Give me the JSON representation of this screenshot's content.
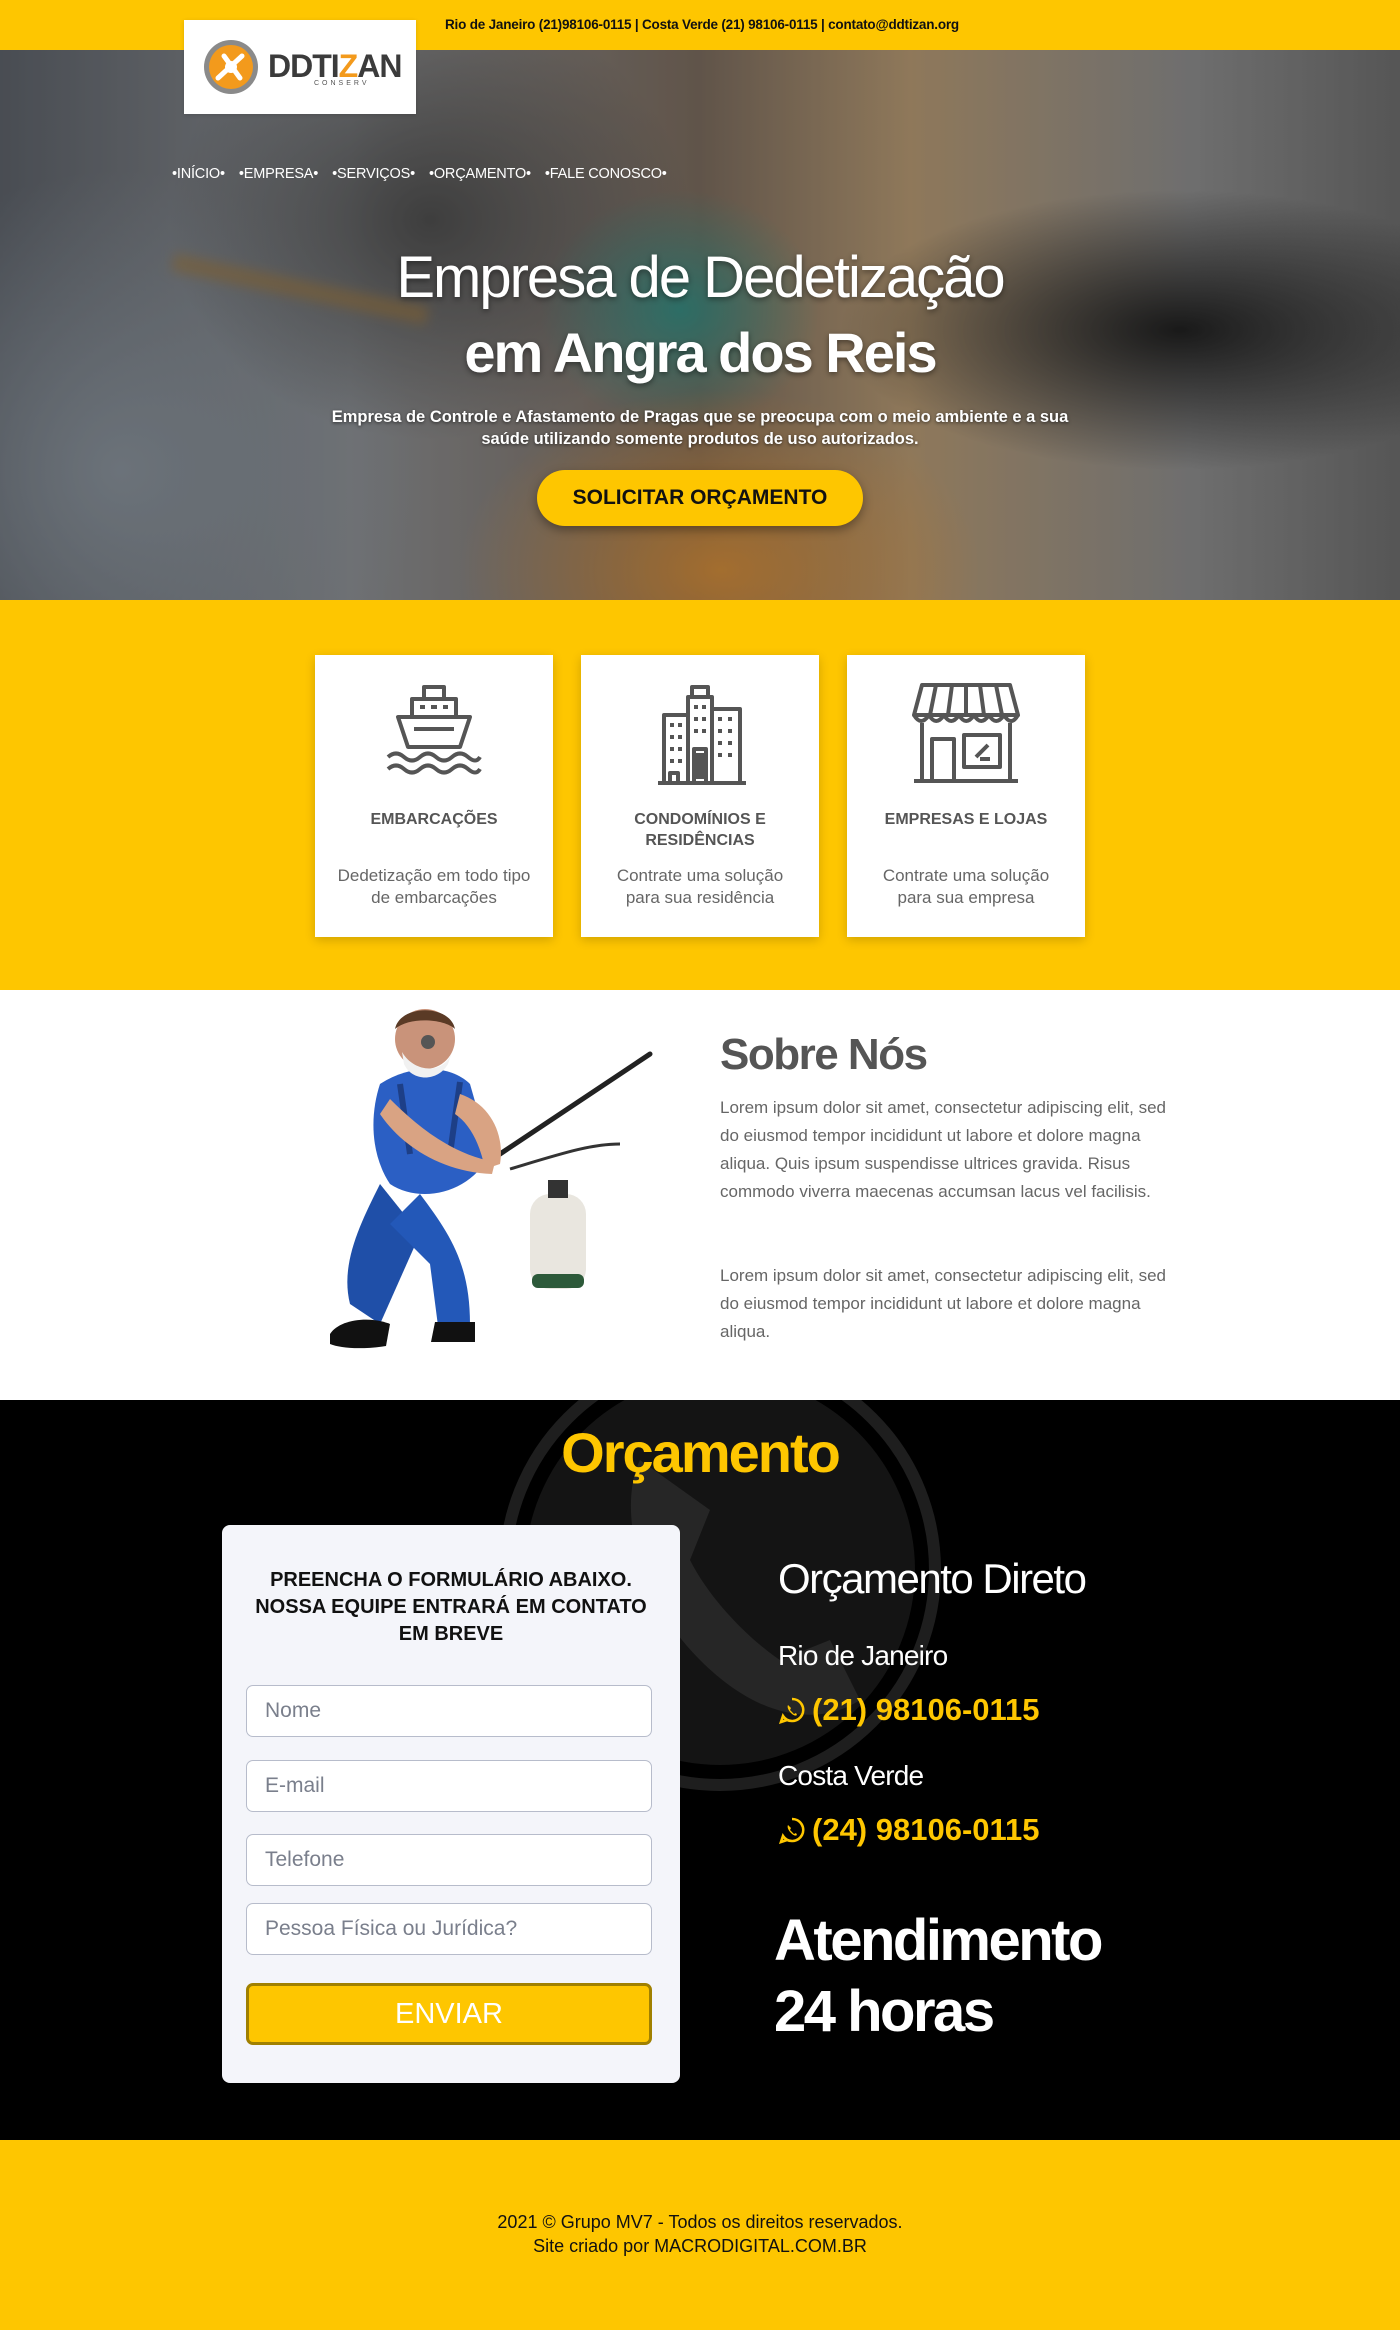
{
  "topbar": {
    "contacts": "Rio de Janeiro (21)98106-0115 | Costa Verde (21) 98106-0115 | contato@ddtizan.org"
  },
  "logo": {
    "brand_a": "DDTI",
    "brand_z": "Z",
    "brand_b": "AN",
    "sub": "CONSERV"
  },
  "nav": {
    "items": [
      "•INÍCIO•",
      "•EMPRESA•",
      "•SERVIÇOS•",
      "•ORÇAMENTO•",
      "•FALE CONOSCO•"
    ]
  },
  "hero": {
    "title_line1": "Empresa de Dedetização",
    "title_line2": "em Angra dos Reis",
    "lead": "Empresa de Controle e Afastamento de Pragas que se preocupa com o meio ambiente e a sua saúde utilizando somente produtos de uso autorizados.",
    "cta": "SOLICITAR ORÇAMENTO"
  },
  "services": [
    {
      "icon": "ship-icon",
      "title": "EMBARCAÇÕES",
      "desc": "Dedetização em todo tipo de embarcações"
    },
    {
      "icon": "buildings-icon",
      "title": "CONDOMÍNIOS E RESIDÊNCIAS",
      "desc": "Contrate uma solução para sua residência"
    },
    {
      "icon": "store-icon",
      "title": "EMPRESAS E LOJAS",
      "desc": "Contrate uma solução para sua empresa"
    }
  ],
  "about": {
    "title": "Sobre Nós",
    "p1": "Lorem ipsum dolor sit amet, consectetur adipiscing elit, sed do eiusmod tempor incididunt ut labore et dolore magna aliqua. Quis ipsum suspendisse ultrices gravida. Risus commodo viverra maecenas accumsan lacus vel facilisis.",
    "p2": "Lorem ipsum dolor sit amet, consectetur adipiscing elit, sed do eiusmod tempor incididunt ut labore et dolore magna aliqua."
  },
  "quote": {
    "title": "Orçamento",
    "form_title": "PREENCHA O FORMULÁRIO ABAIXO. NOSSA EQUIPE ENTRARÁ EM CONTATO EM BREVE",
    "placeholders": {
      "name": "Nome",
      "email": "E-mail",
      "phone": "Telefone",
      "type": "Pessoa Física ou Jurídica?"
    },
    "submit": "ENVIAR",
    "direct_title": "Orçamento Direto",
    "city1": "Rio de Janeiro",
    "phone1": "(21) 98106-0115",
    "city2": "Costa Verde",
    "phone2": "(24) 98106-0115",
    "attendance_line1": "Atendimento",
    "attendance_line2": "24 horas"
  },
  "footer": {
    "line1": "2021 © Grupo MV7 - Todos os direitos reservados.",
    "line2": "Site criado por MACRODIGITAL.COM.BR"
  },
  "colors": {
    "accent": "#fec600",
    "dark": "#000000",
    "text_gray": "#555555"
  }
}
